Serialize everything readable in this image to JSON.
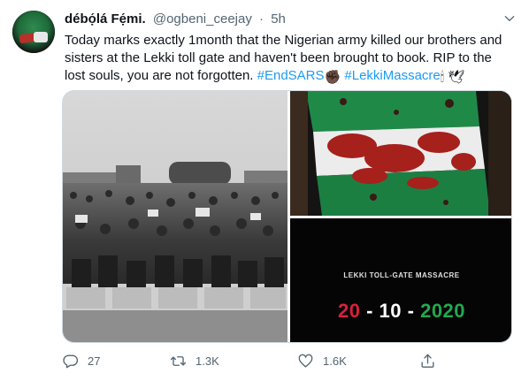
{
  "tweet": {
    "display_name": "débọ́lá Fẹ́mi.",
    "handle": "@ogbeni_ceejay",
    "separator": "·",
    "time": "5h",
    "text_line1": "Today marks exactly 1month that the Nigerian army killed our brothers and",
    "text_line2": "sisters at the Lekki toll gate and haven't been brought to book. RIP to the",
    "text_line3": "lost souls, you are not forgotten.",
    "hashtag1": "#EndSARS",
    "hashtag2": "#LekkiMassacre",
    "emoji1": "✊🏿",
    "emoji2": "🕯",
    "emoji3": "🕊"
  },
  "media": {
    "photo3_title": "LEKKI TOLL-GATE MASSACRE",
    "photo3_date_day": "20",
    "photo3_date_month": "10",
    "photo3_date_year": "2020",
    "photo3_sep": "-"
  },
  "actions": {
    "replies": "27",
    "retweets": "1.3K",
    "likes": "1.6K"
  },
  "icons": {
    "more": "chevron-down-icon",
    "reply": "reply-icon",
    "retweet": "retweet-icon",
    "like": "heart-icon",
    "share": "share-icon"
  },
  "colors": {
    "link": "#1d9bf0",
    "muted": "#536471",
    "date_red": "#d8203a",
    "date_green": "#23a84e"
  }
}
